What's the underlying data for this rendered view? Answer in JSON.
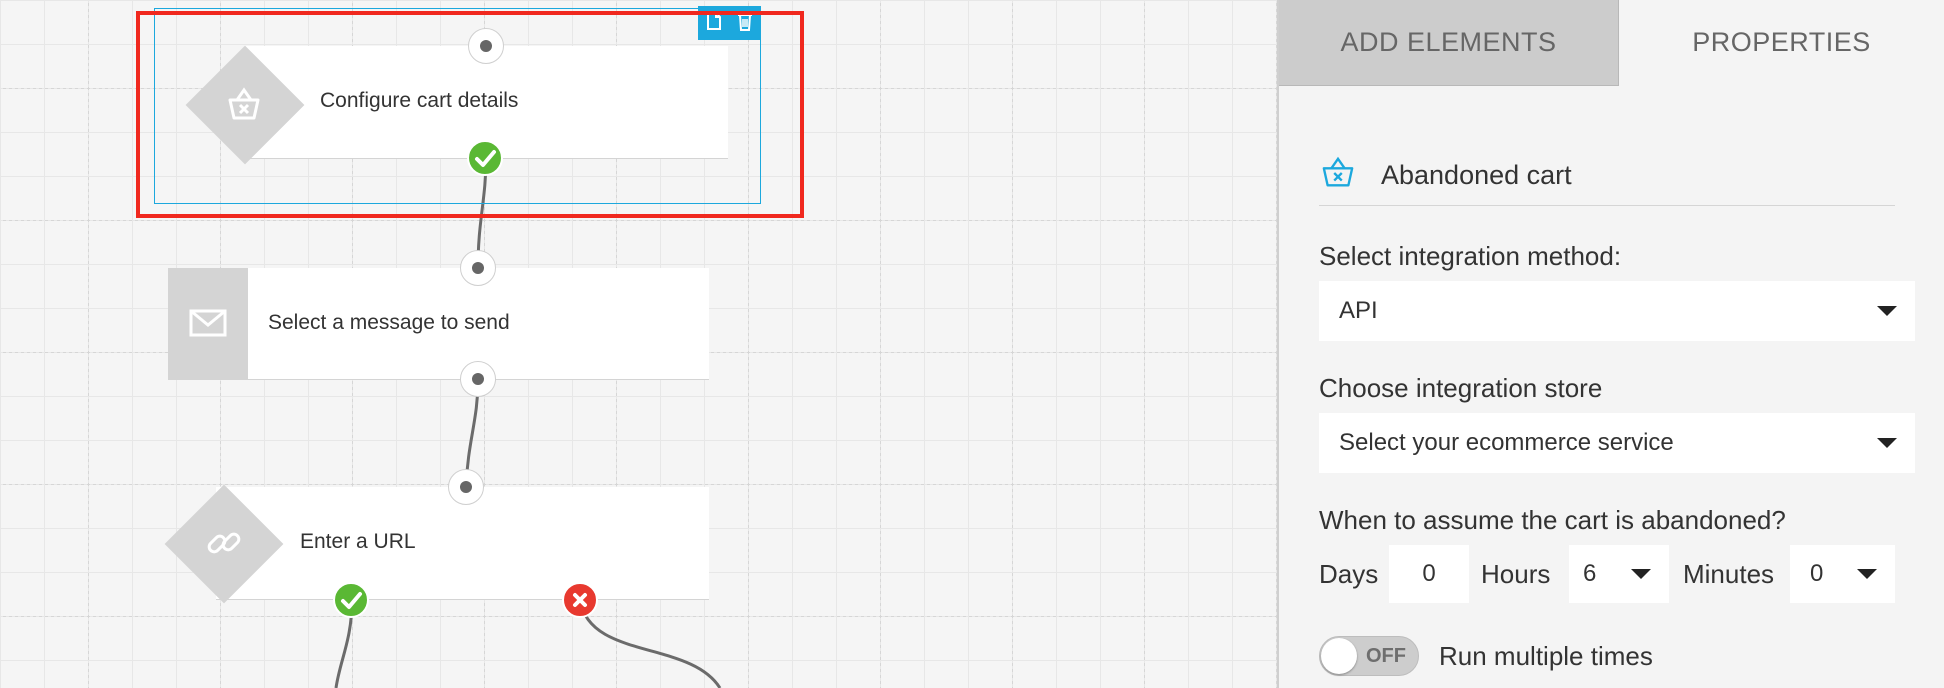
{
  "colors": {
    "accent": "#1ca8dd",
    "success": "#5ab834",
    "error": "#e8392f",
    "highlight": "#f0281e",
    "node_icon_bg": "#d4d4d4"
  },
  "canvas": {
    "nodes": [
      {
        "label": "Configure cart details",
        "icon": "basket-icon",
        "shape": "diamond",
        "selected": true
      },
      {
        "label": "Select a message to send",
        "icon": "envelope-icon",
        "shape": "square"
      },
      {
        "label": "Enter a URL",
        "icon": "link-icon",
        "shape": "diamond"
      }
    ],
    "selection_tools": [
      "copy-icon",
      "trash-icon"
    ],
    "status_icons": [
      "check-icon",
      "close-icon"
    ]
  },
  "panel": {
    "tabs": [
      {
        "label": "ADD ELEMENTS",
        "active": false
      },
      {
        "label": "PROPERTIES",
        "active": true
      }
    ],
    "element": {
      "icon": "basket-icon",
      "name": "Abandoned cart"
    },
    "integration_method": {
      "label": "Select integration method:",
      "value": "API"
    },
    "integration_store": {
      "label": "Choose integration store",
      "value": "Select your ecommerce service"
    },
    "abandon_time": {
      "label": "When to assume the cart is abandoned?",
      "days_label": "Days",
      "days_value": "0",
      "hours_label": "Hours",
      "hours_value": "6",
      "minutes_label": "Minutes",
      "minutes_value": "0"
    },
    "run_multiple": {
      "toggle_text": "OFF",
      "label": "Run multiple times",
      "on": false
    }
  }
}
